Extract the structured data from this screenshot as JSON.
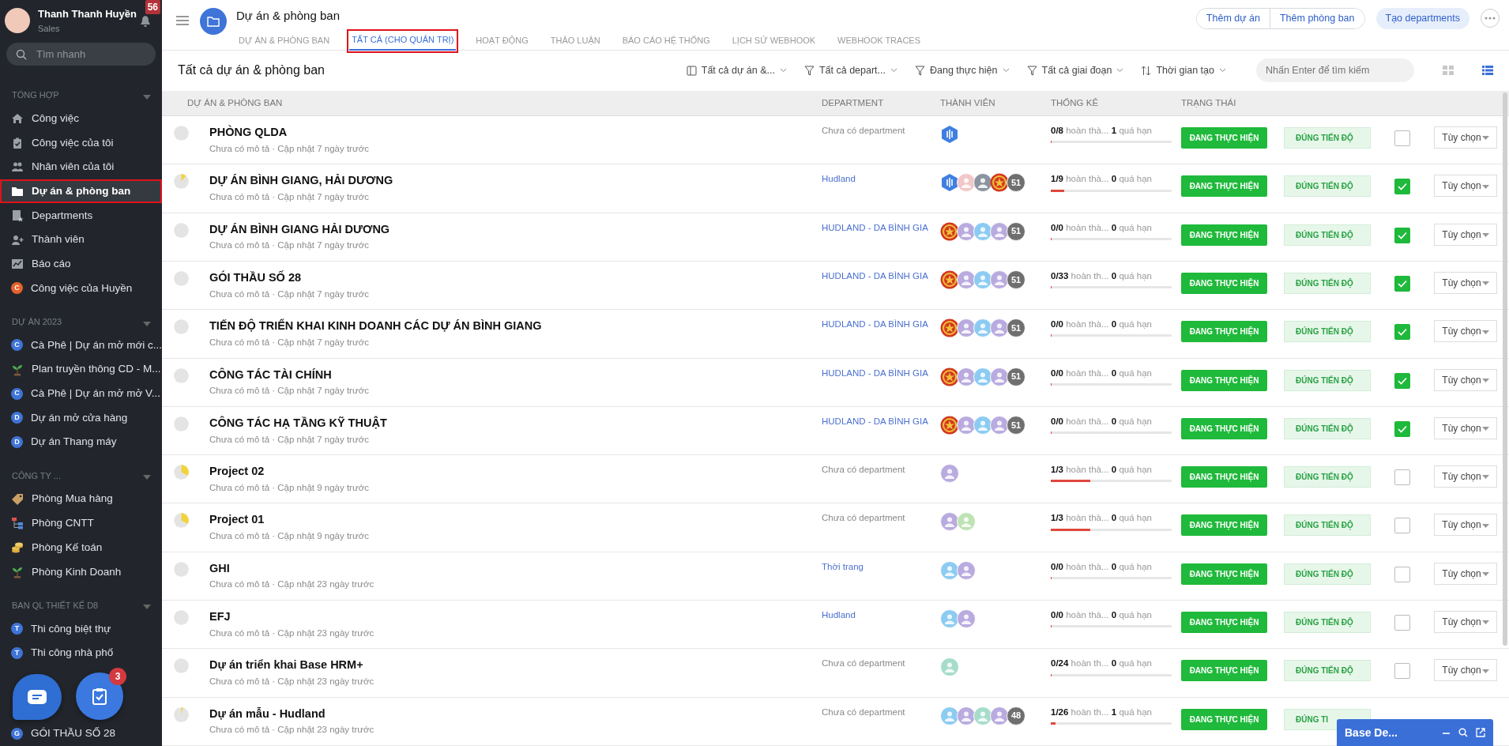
{
  "user": {
    "name": "Thanh Thanh Huyền",
    "role": "Sales",
    "notifications": "56"
  },
  "search": {
    "placeholder": "Tìm nhanh"
  },
  "sidebar": {
    "sections": [
      {
        "title": "TỔNG HỢP",
        "expanded": true,
        "items": [
          {
            "label": "Công việc",
            "kind": "home",
            "selected": false
          },
          {
            "label": "Công việc của tôi",
            "kind": "clipboard",
            "selected": false
          },
          {
            "label": "Nhân viên của tôi",
            "kind": "people",
            "selected": false
          },
          {
            "label": "Dự án & phòng ban",
            "kind": "folder",
            "selected": true
          },
          {
            "label": "Departments",
            "kind": "badge",
            "selected": false
          },
          {
            "label": "Thành viên",
            "kind": "person-add",
            "selected": false
          },
          {
            "label": "Báo cáo",
            "kind": "chart",
            "selected": false
          },
          {
            "label": "Công việc của Huyền",
            "kind": "letter",
            "letter": "C",
            "color": "#e8622c",
            "selected": false
          }
        ]
      },
      {
        "title": "DỰ ÁN 2023",
        "expanded": true,
        "items": [
          {
            "label": "Cà Phê | Dự án mở mới c...",
            "kind": "letter",
            "letter": "C",
            "color": "#3f74d8",
            "selected": false
          },
          {
            "label": "Plan truyền thông CD - M...",
            "kind": "plant",
            "selected": false
          },
          {
            "label": "Cà Phê | Dự án mở mở V...",
            "kind": "letter",
            "letter": "C",
            "color": "#3f74d8",
            "selected": false
          },
          {
            "label": "Dự án mở cửa hàng",
            "kind": "letter",
            "letter": "D",
            "color": "#3f74d8",
            "selected": false
          },
          {
            "label": "Dự án Thang máy",
            "kind": "letter",
            "letter": "D",
            "color": "#3f74d8",
            "selected": false
          }
        ]
      },
      {
        "title": "CÔNG TY ...",
        "expanded": true,
        "items": [
          {
            "label": "Phòng Mua hàng",
            "kind": "tag",
            "selected": false
          },
          {
            "label": "Phòng CNTT",
            "kind": "org",
            "selected": false
          },
          {
            "label": "Phòng Kế toán",
            "kind": "coins",
            "selected": false
          },
          {
            "label": "Phòng Kinh Doanh",
            "kind": "plant",
            "selected": false
          }
        ]
      },
      {
        "title": "BAN QL THIẾT KẾ D8",
        "expanded": true,
        "items": [
          {
            "label": "Thi công biệt thự",
            "kind": "letter",
            "letter": "T",
            "color": "#3f74d8",
            "selected": false
          },
          {
            "label": "Thi công nhà phố",
            "kind": "letter",
            "letter": "T",
            "color": "#3f74d8",
            "selected": false
          }
        ]
      },
      {
        "items": [
          {
            "label": "GÓI THẦU SỐ 28",
            "kind": "letter",
            "letter": "G",
            "color": "#3f74d8",
            "selected": false
          }
        ]
      }
    ]
  },
  "fab": {
    "task_count": "3"
  },
  "header": {
    "title": "Dự án & phòng ban",
    "tabs": [
      {
        "label": "DỰ ÁN & PHÒNG BAN",
        "selected": false
      },
      {
        "label": "TẤT CẢ (CHO QUẢN TRỊ)",
        "selected": true
      },
      {
        "label": "HOẠT ĐỘNG",
        "selected": false
      },
      {
        "label": "THẢO LUẬN",
        "selected": false
      },
      {
        "label": "BÁO CÁO HỆ THỐNG",
        "selected": false
      },
      {
        "label": "LỊCH SỬ WEBHOOK",
        "selected": false
      },
      {
        "label": "WEBHOOK TRACES",
        "selected": false
      }
    ],
    "buttons": [
      "Thêm dự án",
      "Thêm phòng ban"
    ],
    "primary_button": "Tạo departments"
  },
  "toolbar": {
    "title": "Tất cả dự án & phòng ban",
    "filters": [
      {
        "kind": "panel",
        "label": "Tất cả dự án &..."
      },
      {
        "kind": "filter",
        "label": "Tất cả depart..."
      },
      {
        "kind": "filter",
        "label": "Đang thực hiện"
      },
      {
        "kind": "filter",
        "label": "Tất cả giai đoạn"
      },
      {
        "kind": "sort",
        "label": "Thời gian tạo"
      }
    ],
    "search_placeholder": "Nhấn Enter để tìm kiếm",
    "views": [
      {
        "kind": "grid",
        "selected": false
      },
      {
        "kind": "list",
        "selected": true
      }
    ]
  },
  "table": {
    "columns": [
      "DỰ ÁN & PHÒNG BAN",
      "DEPARTMENT",
      "THÀNH VIÊN",
      "THỐNG KÊ",
      "TRẠNG THÁI"
    ],
    "rows": [
      {
        "name": "PHÒNG QLDA",
        "meta": "Chưa có mô tả · Cập nhật 7 ngày trước",
        "department": {
          "kind": "none",
          "text": "Chưa có department"
        },
        "members": [
          {
            "kind": "hexagon"
          }
        ],
        "stats": {
          "count": "0/8",
          "done_label": "hoàn thà...",
          "overdue": "1",
          "overdue_label": "quá hạn",
          "level": 0
        },
        "status": "ĐANG THỰC HIỆN",
        "schedule": "ĐÚNG TIẾN ĐỘ",
        "checked": false,
        "options": "Tùy chọn"
      },
      {
        "name": "DỰ ÁN BÌNH GIANG, HẢI DƯƠNG",
        "meta": "Chưa có mô tả · Cập nhật 7 ngày trước",
        "department": {
          "kind": "link",
          "text": "Hudland"
        },
        "members": [
          {
            "kind": "hexagon"
          },
          {
            "kind": "photo",
            "color": "#f3c7c7"
          },
          {
            "kind": "photo",
            "color": "#8a94a0"
          },
          {
            "kind": "emblem"
          },
          {
            "kind": "count",
            "text": "51"
          }
        ],
        "stats": {
          "count": "1/9",
          "done_label": "hoàn thà...",
          "overdue": "0",
          "overdue_label": "quá hạn",
          "level": 0.11
        },
        "status": "ĐANG THỰC HIỆN",
        "schedule": "ĐÚNG TIẾN ĐỘ",
        "checked": true,
        "options": "Tùy chọn"
      },
      {
        "name": "DỰ ÁN BÌNH GIANG HẢI DƯƠNG",
        "meta": "Chưa có mô tả · Cập nhật 7 ngày trước",
        "department": {
          "kind": "link",
          "text": "HUDLAND - DA BÌNH GIA"
        },
        "members": [
          {
            "kind": "emblem"
          },
          {
            "kind": "user",
            "color": "#b9abdf"
          },
          {
            "kind": "user",
            "color": "#8ccbf2"
          },
          {
            "kind": "user",
            "color": "#b9abdf"
          },
          {
            "kind": "count",
            "text": "51"
          }
        ],
        "stats": {
          "count": "0/0",
          "done_label": "hoàn thà...",
          "overdue": "0",
          "overdue_label": "quá hạn",
          "level": 0
        },
        "status": "ĐANG THỰC HIỆN",
        "schedule": "ĐÚNG TIẾN ĐỘ",
        "checked": true,
        "options": "Tùy chọn"
      },
      {
        "name": "GÓI THẦU SỐ 28",
        "meta": "Chưa có mô tả · Cập nhật 7 ngày trước",
        "department": {
          "kind": "link",
          "text": "HUDLAND - DA BÌNH GIA"
        },
        "members": [
          {
            "kind": "emblem"
          },
          {
            "kind": "user",
            "color": "#b9abdf"
          },
          {
            "kind": "user",
            "color": "#8ccbf2"
          },
          {
            "kind": "user",
            "color": "#b9abdf"
          },
          {
            "kind": "count",
            "text": "51"
          }
        ],
        "stats": {
          "count": "0/33",
          "done_label": "hoàn th...",
          "overdue": "0",
          "overdue_label": "quá hạn",
          "level": 0
        },
        "status": "ĐANG THỰC HIỆN",
        "schedule": "ĐÚNG TIẾN ĐỘ",
        "checked": true,
        "options": "Tùy chọn"
      },
      {
        "name": "TIẾN ĐỘ TRIỂN KHAI KINH DOANH CÁC DỰ ÁN BÌNH GIANG",
        "meta": "Chưa có mô tả · Cập nhật 7 ngày trước",
        "department": {
          "kind": "link",
          "text": "HUDLAND - DA BÌNH GIA"
        },
        "members": [
          {
            "kind": "emblem"
          },
          {
            "kind": "user",
            "color": "#b9abdf"
          },
          {
            "kind": "user",
            "color": "#8ccbf2"
          },
          {
            "kind": "user",
            "color": "#b9abdf"
          },
          {
            "kind": "count",
            "text": "51"
          }
        ],
        "stats": {
          "count": "0/0",
          "done_label": "hoàn thà...",
          "overdue": "0",
          "overdue_label": "quá hạn",
          "level": 0
        },
        "status": "ĐANG THỰC HIỆN",
        "schedule": "ĐÚNG TIẾN ĐỘ",
        "checked": true,
        "options": "Tùy chọn"
      },
      {
        "name": "CÔNG TÁC TÀI CHÍNH",
        "meta": "Chưa có mô tả · Cập nhật 7 ngày trước",
        "department": {
          "kind": "link",
          "text": "HUDLAND - DA BÌNH GIA"
        },
        "members": [
          {
            "kind": "emblem"
          },
          {
            "kind": "user",
            "color": "#b9abdf"
          },
          {
            "kind": "user",
            "color": "#8ccbf2"
          },
          {
            "kind": "user",
            "color": "#b9abdf"
          },
          {
            "kind": "count",
            "text": "51"
          }
        ],
        "stats": {
          "count": "0/0",
          "done_label": "hoàn thà...",
          "overdue": "0",
          "overdue_label": "quá hạn",
          "level": 0
        },
        "status": "ĐANG THỰC HIỆN",
        "schedule": "ĐÚNG TIẾN ĐỘ",
        "checked": true,
        "options": "Tùy chọn"
      },
      {
        "name": "CÔNG TÁC HẠ TẦNG KỸ THUẬT",
        "meta": "Chưa có mô tả · Cập nhật 7 ngày trước",
        "department": {
          "kind": "link",
          "text": "HUDLAND - DA BÌNH GIA"
        },
        "members": [
          {
            "kind": "emblem"
          },
          {
            "kind": "user",
            "color": "#b9abdf"
          },
          {
            "kind": "user",
            "color": "#8ccbf2"
          },
          {
            "kind": "user",
            "color": "#b9abdf"
          },
          {
            "kind": "count",
            "text": "51"
          }
        ],
        "stats": {
          "count": "0/0",
          "done_label": "hoàn thà...",
          "overdue": "0",
          "overdue_label": "quá hạn",
          "level": 0
        },
        "status": "ĐANG THỰC HIỆN",
        "schedule": "ĐÚNG TIẾN ĐỘ",
        "checked": true,
        "options": "Tùy chọn"
      },
      {
        "name": "Project 02",
        "meta": "Chưa có mô tả · Cập nhật 9 ngày trước",
        "department": {
          "kind": "none",
          "text": "Chưa có department"
        },
        "members": [
          {
            "kind": "user",
            "color": "#b9abdf"
          }
        ],
        "stats": {
          "count": "1/3",
          "done_label": "hoàn thà...",
          "overdue": "0",
          "overdue_label": "quá hạn",
          "level": 0.33
        },
        "status": "ĐANG THỰC HIỆN",
        "schedule": "ĐÚNG TIẾN ĐỘ",
        "checked": false,
        "options": "Tùy chọn"
      },
      {
        "name": "Project 01",
        "meta": "Chưa có mô tả · Cập nhật 9 ngày trước",
        "department": {
          "kind": "none",
          "text": "Chưa có department"
        },
        "members": [
          {
            "kind": "user",
            "color": "#b9abdf"
          },
          {
            "kind": "user",
            "color": "#bfe3b4"
          }
        ],
        "stats": {
          "count": "1/3",
          "done_label": "hoàn thà...",
          "overdue": "0",
          "overdue_label": "quá hạn",
          "level": 0.33
        },
        "status": "ĐANG THỰC HIỆN",
        "schedule": "ĐÚNG TIẾN ĐỘ",
        "checked": false,
        "options": "Tùy chọn"
      },
      {
        "name": "GHI",
        "meta": "Chưa có mô tả · Cập nhật 23 ngày trước",
        "department": {
          "kind": "link",
          "text": "Thời trang"
        },
        "members": [
          {
            "kind": "user",
            "color": "#8ccbf2"
          },
          {
            "kind": "user",
            "color": "#b9abdf"
          }
        ],
        "stats": {
          "count": "0/0",
          "done_label": "hoàn thà...",
          "overdue": "0",
          "overdue_label": "quá hạn",
          "level": 0
        },
        "status": "ĐANG THỰC HIỆN",
        "schedule": "ĐÚNG TIẾN ĐỘ",
        "checked": false,
        "options": "Tùy chọn"
      },
      {
        "name": "EFJ",
        "meta": "Chưa có mô tả · Cập nhật 23 ngày trước",
        "department": {
          "kind": "link",
          "text": "Hudland"
        },
        "members": [
          {
            "kind": "user",
            "color": "#8ccbf2"
          },
          {
            "kind": "user",
            "color": "#b9abdf"
          }
        ],
        "stats": {
          "count": "0/0",
          "done_label": "hoàn thà...",
          "overdue": "0",
          "overdue_label": "quá hạn",
          "level": 0
        },
        "status": "ĐANG THỰC HIỆN",
        "schedule": "ĐÚNG TIẾN ĐỘ",
        "checked": false,
        "options": "Tùy chọn"
      },
      {
        "name": "Dự án triển khai Base HRM+",
        "meta": "Chưa có mô tả · Cập nhật 23 ngày trước",
        "department": {
          "kind": "none",
          "text": "Chưa có department"
        },
        "members": [
          {
            "kind": "user",
            "color": "#a6dccb"
          }
        ],
        "stats": {
          "count": "0/24",
          "done_label": "hoàn th...",
          "overdue": "0",
          "overdue_label": "quá hạn",
          "level": 0
        },
        "status": "ĐANG THỰC HIỆN",
        "schedule": "ĐÚNG TIẾN ĐỘ",
        "checked": false,
        "options": "Tùy chọn"
      },
      {
        "name": "Dự án mẫu - Hudland",
        "meta": "Chưa có mô tả · Cập nhật 23 ngày trước",
        "department": {
          "kind": "none",
          "text": "Chưa có department"
        },
        "members": [
          {
            "kind": "user",
            "color": "#8ccbf2"
          },
          {
            "kind": "user",
            "color": "#b9abdf"
          },
          {
            "kind": "user",
            "color": "#a6dccb"
          },
          {
            "kind": "user",
            "color": "#b9abdf"
          },
          {
            "kind": "count",
            "text": "48"
          }
        ],
        "stats": {
          "count": "1/26",
          "done_label": "hoàn th...",
          "overdue": "1",
          "overdue_label": "quá hạn",
          "level": 0.04
        },
        "status": "ĐANG THỰC HIỆN",
        "schedule": "ĐÚNG TI"
      }
    ]
  },
  "chat_popup": {
    "title": "Base De..."
  }
}
